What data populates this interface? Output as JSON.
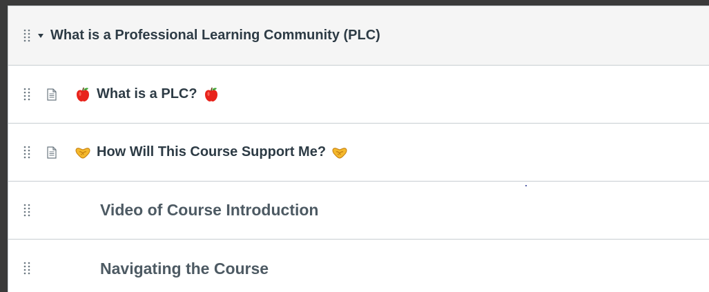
{
  "module": {
    "title": "What is a Professional Learning Community (PLC)",
    "expanded": true
  },
  "items": [
    {
      "type": "page",
      "icon": "page-icon",
      "emoji": "red-apple-icon",
      "title": "What is a PLC?"
    },
    {
      "type": "page",
      "icon": "page-icon",
      "emoji": "handshake-icon",
      "title": "How Will This Course Support Me?"
    },
    {
      "type": "subheader",
      "title": "Video of Course Introduction"
    },
    {
      "type": "subheader",
      "title": "Navigating the Course"
    }
  ],
  "colors": {
    "text": "#2d3b45",
    "subheader_text": "#4d5a63",
    "header_bg": "#f5f5f5",
    "border": "#c7cdd1",
    "outer_bg": "#3a3a3a"
  }
}
